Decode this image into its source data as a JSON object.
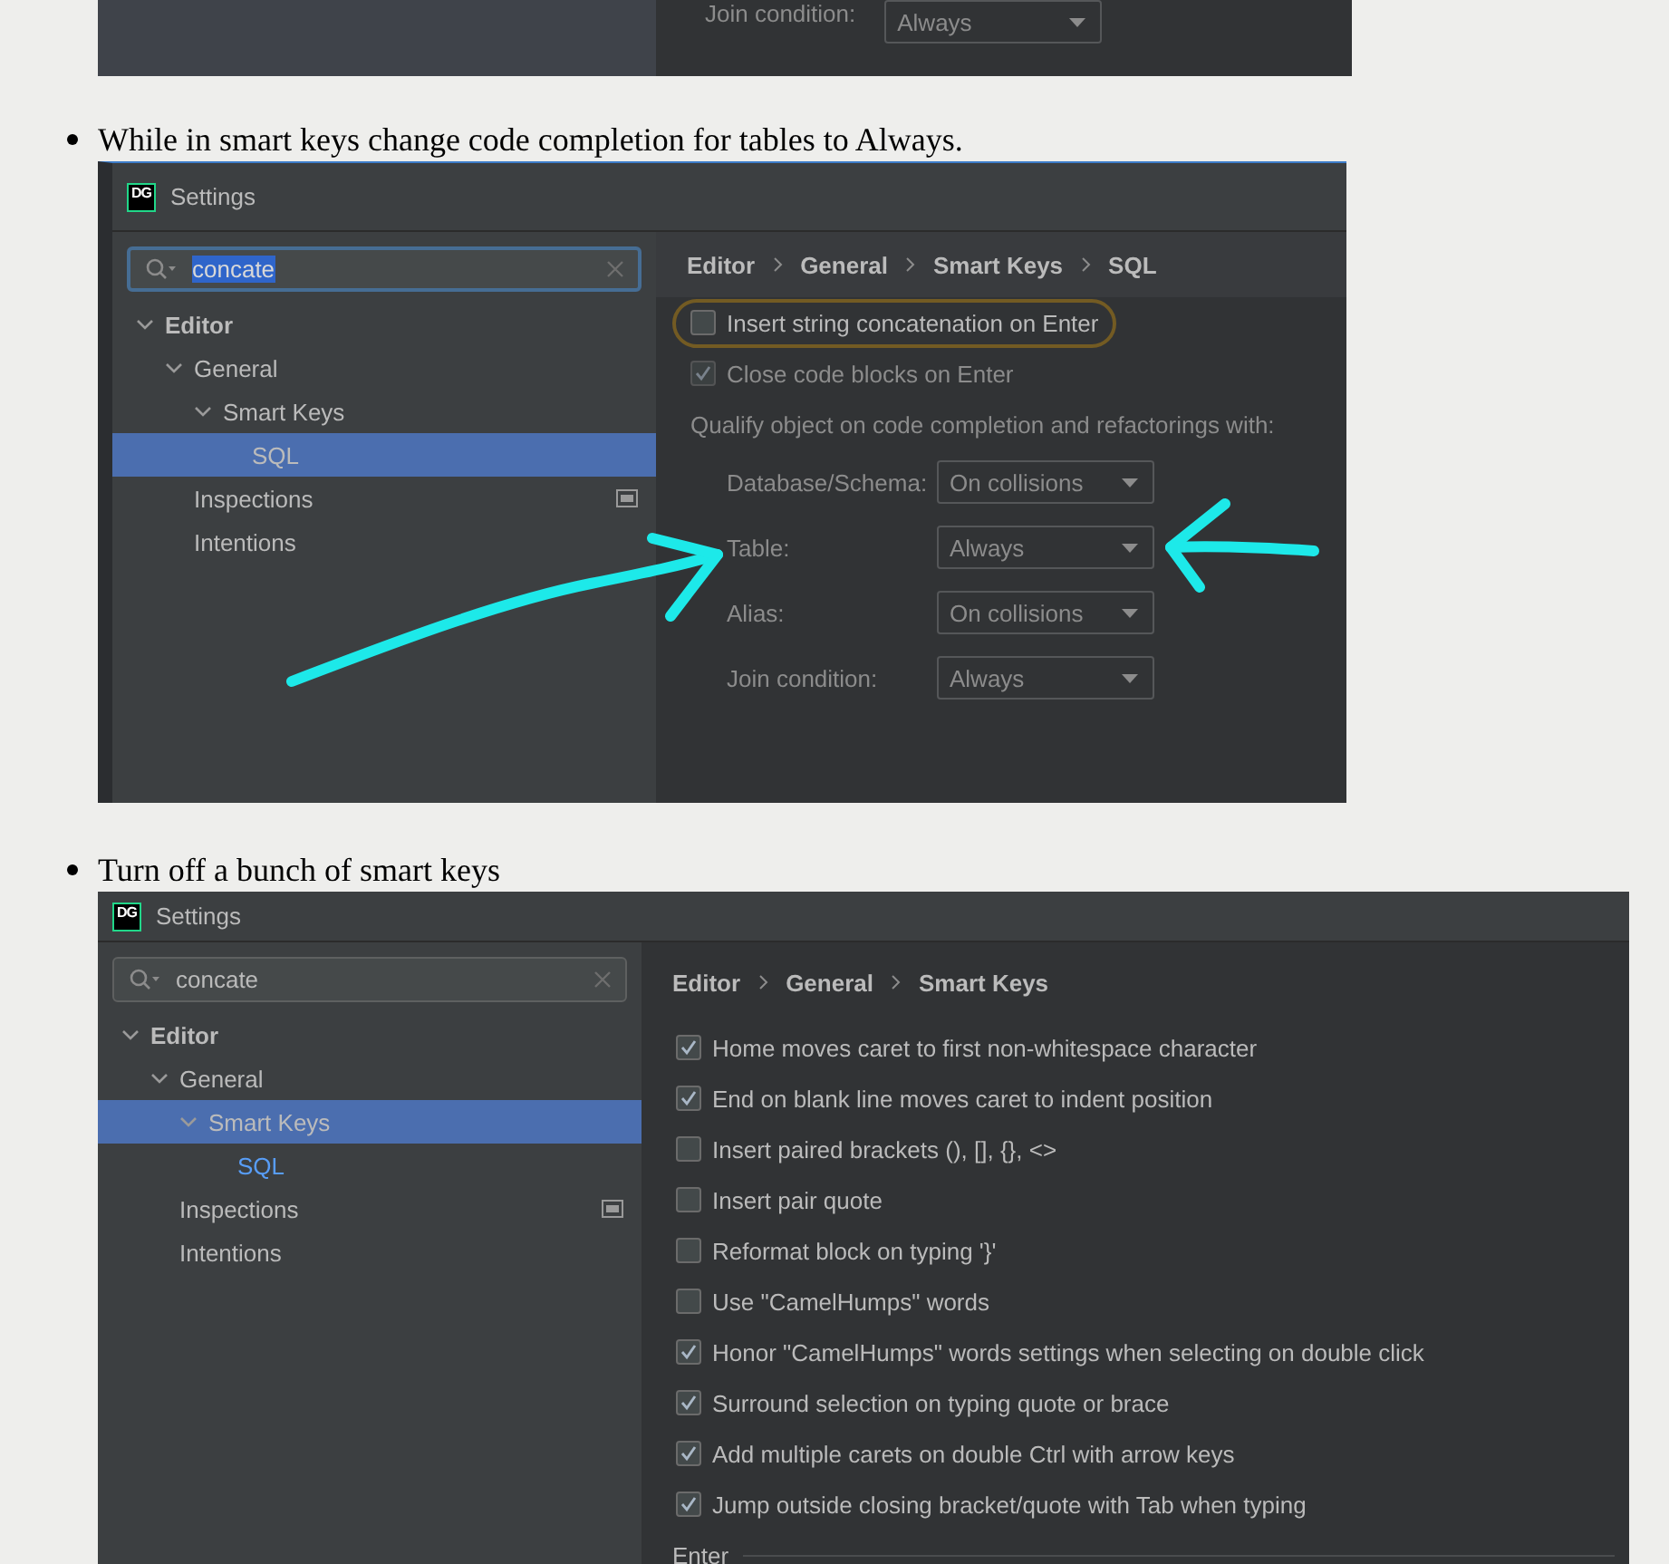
{
  "top_fragment": {
    "label": "Join condition:",
    "dropdown": "Always"
  },
  "items": [
    {
      "text": "While in smart keys change code completion for tables to Always.",
      "screenshot": {
        "logo_text": "DG",
        "title": "Settings",
        "search": {
          "value": "concate",
          "text_selected": true
        },
        "tree": [
          {
            "label": "Editor",
            "bold": true,
            "expanded": true,
            "selected": false,
            "modified": false,
            "scope_icon": false,
            "children": [
              {
                "label": "General",
                "bold": false,
                "expanded": true,
                "selected": false,
                "modified": false,
                "scope_icon": false,
                "children": [
                  {
                    "label": "Smart Keys",
                    "bold": false,
                    "expanded": true,
                    "selected": false,
                    "modified": false,
                    "scope_icon": false,
                    "children": [
                      {
                        "label": "SQL",
                        "bold": false,
                        "selected": true,
                        "modified": false,
                        "scope_icon": false
                      }
                    ]
                  }
                ]
              },
              {
                "label": "Inspections",
                "bold": false,
                "selected": false,
                "modified": false,
                "scope_icon": true
              },
              {
                "label": "Intentions",
                "bold": false,
                "selected": false,
                "modified": false,
                "scope_icon": false
              }
            ]
          }
        ],
        "breadcrumb": [
          "Editor",
          "General",
          "Smart Keys",
          "SQL"
        ],
        "content": [
          {
            "kind": "checkbox",
            "label": "Insert string concatenation on Enter",
            "checked": false,
            "disabled": false,
            "highlighted": true
          },
          {
            "kind": "checkbox",
            "label": "Close code blocks on Enter",
            "checked": true,
            "disabled": true,
            "highlighted": false
          },
          {
            "kind": "note",
            "text": "Qualify object on code completion and refactorings with:"
          },
          {
            "kind": "dropdown",
            "label": "Database/Schema:",
            "value": "On collisions"
          },
          {
            "kind": "dropdown",
            "label": "Table:",
            "value": "Always"
          },
          {
            "kind": "dropdown",
            "label": "Alias:",
            "value": "On collisions"
          },
          {
            "kind": "dropdown",
            "label": "Join condition:",
            "value": "Always"
          }
        ],
        "annotations": [
          {
            "kind": "curved-arrow"
          },
          {
            "kind": "straight-arrow"
          }
        ]
      }
    },
    {
      "text": "Turn off a bunch of smart keys",
      "screenshot": {
        "logo_text": "DG",
        "title": "Settings",
        "search": {
          "value": "concate",
          "text_selected": false
        },
        "tree": [
          {
            "label": "Editor",
            "bold": true,
            "expanded": true,
            "selected": false,
            "modified": false,
            "scope_icon": false,
            "children": [
              {
                "label": "General",
                "bold": false,
                "expanded": true,
                "selected": false,
                "modified": false,
                "scope_icon": false,
                "children": [
                  {
                    "label": "Smart Keys",
                    "bold": false,
                    "expanded": true,
                    "selected": true,
                    "modified": false,
                    "scope_icon": false,
                    "children": [
                      {
                        "label": "SQL",
                        "bold": false,
                        "selected": false,
                        "modified": true,
                        "scope_icon": false
                      }
                    ]
                  }
                ]
              },
              {
                "label": "Inspections",
                "bold": false,
                "selected": false,
                "modified": false,
                "scope_icon": true
              },
              {
                "label": "Intentions",
                "bold": false,
                "selected": false,
                "modified": false,
                "scope_icon": false
              }
            ]
          }
        ],
        "breadcrumb": [
          "Editor",
          "General",
          "Smart Keys"
        ],
        "content": [
          {
            "kind": "checkbox",
            "label": "Home moves caret to first non-whitespace character",
            "checked": true,
            "disabled": false,
            "highlighted": false
          },
          {
            "kind": "checkbox",
            "label": "End on blank line moves caret to indent position",
            "checked": true,
            "disabled": false,
            "highlighted": false
          },
          {
            "kind": "checkbox",
            "label": "Insert paired brackets (), [], {}, <>",
            "checked": false,
            "disabled": false,
            "highlighted": false
          },
          {
            "kind": "checkbox",
            "label": "Insert pair quote",
            "checked": false,
            "disabled": false,
            "highlighted": false
          },
          {
            "kind": "checkbox",
            "label": "Reformat block on typing '}'",
            "checked": false,
            "disabled": false,
            "highlighted": false
          },
          {
            "kind": "checkbox",
            "label": "Use \"CamelHumps\" words",
            "checked": false,
            "disabled": false,
            "highlighted": false
          },
          {
            "kind": "checkbox",
            "label": "Honor \"CamelHumps\" words settings when selecting on double click",
            "checked": true,
            "disabled": false,
            "highlighted": false
          },
          {
            "kind": "checkbox",
            "label": "Surround selection on typing quote or brace",
            "checked": true,
            "disabled": false,
            "highlighted": false
          },
          {
            "kind": "checkbox",
            "label": "Add multiple carets on double Ctrl with arrow keys",
            "checked": true,
            "disabled": false,
            "highlighted": false
          },
          {
            "kind": "checkbox",
            "label": "Jump outside closing bracket/quote with Tab when typing",
            "checked": true,
            "disabled": false,
            "highlighted": false
          },
          {
            "kind": "section",
            "title": "Enter"
          }
        ]
      }
    }
  ]
}
